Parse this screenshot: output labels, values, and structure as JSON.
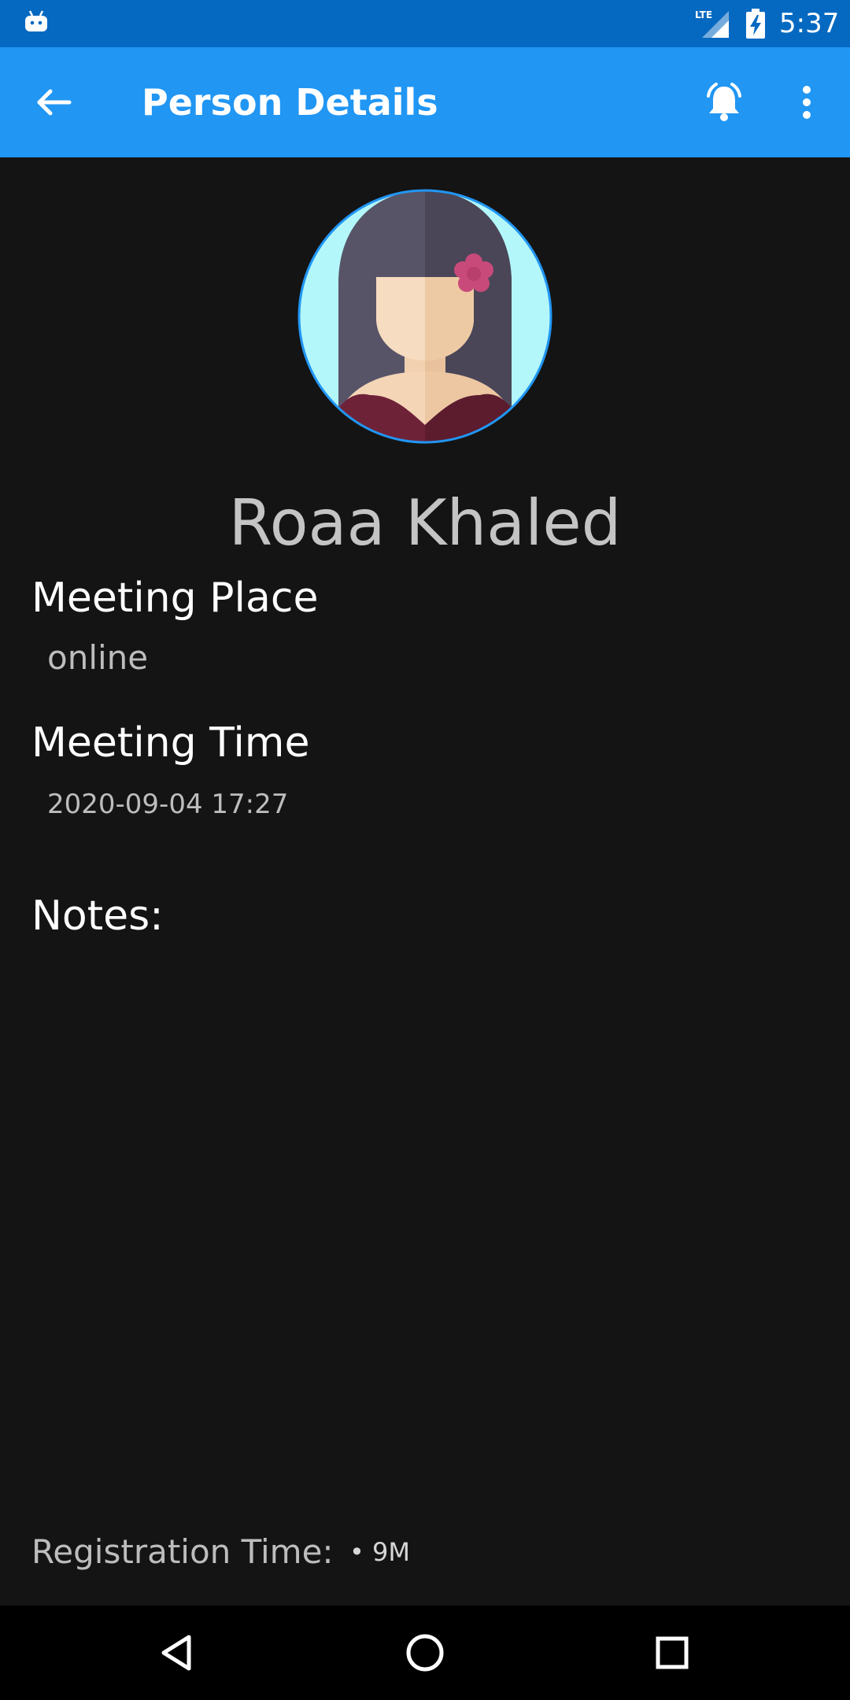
{
  "status_bar": {
    "network": "LTE",
    "time": "5:37",
    "icons": [
      "android-notification-icon",
      "lte-signal-icon",
      "battery-charging-icon"
    ]
  },
  "app_bar": {
    "title": "Person Details",
    "back_icon": "arrow-left-icon",
    "bell_icon": "alarm-bell-icon",
    "menu_icon": "more-vertical-icon"
  },
  "person": {
    "name": "Roaa Khaled",
    "avatar_icon": "female-avatar-icon"
  },
  "details": {
    "meeting_place_label": "Meeting Place",
    "meeting_place_value": "online",
    "meeting_time_label": "Meeting Time",
    "meeting_time_value": "2020-09-04 17:27",
    "notes_label": "Notes:",
    "registration_label": "Registration Time:",
    "registration_value": "• 9M"
  },
  "nav_bar": {
    "icons": [
      "nav-back-icon",
      "nav-home-icon",
      "nav-recents-icon"
    ]
  },
  "colors": {
    "status_bar": "#0669c1",
    "app_bar": "#2196f3",
    "background": "#141414",
    "avatar_ring": "#2196f3",
    "avatar_bg": "#b3f7fb",
    "flower": "#c84a7a"
  }
}
